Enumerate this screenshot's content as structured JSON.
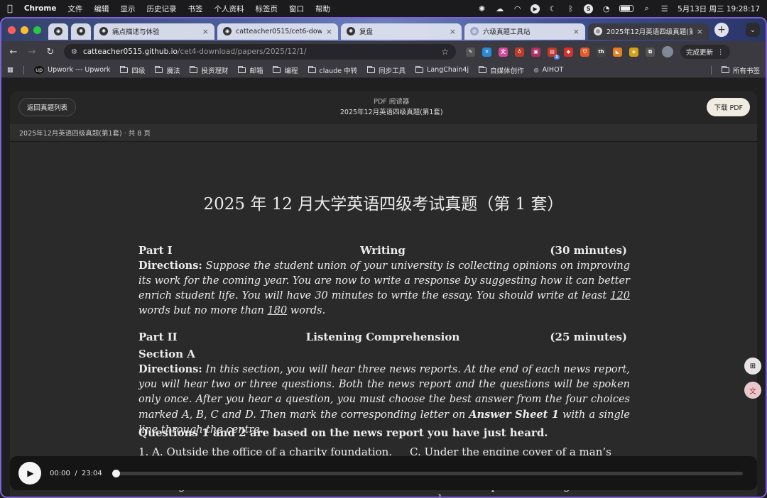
{
  "menubar": {
    "app_name": "Chrome",
    "items": [
      "文件",
      "编辑",
      "显示",
      "历史记录",
      "书签",
      "个人资料",
      "标签页",
      "窗口",
      "帮助"
    ],
    "datetime": "5月13日 周三  19:28:17"
  },
  "tabs": [
    {
      "title": "",
      "icon": "github-icon",
      "pinned": true
    },
    {
      "title": "",
      "icon": "chatgpt-icon",
      "pinned": true
    },
    {
      "title": "痛点描述与体验",
      "icon": "chatgpt-icon"
    },
    {
      "title": "catteacher0515/cet6-downlo",
      "icon": "github-icon"
    },
    {
      "title": "复盘",
      "icon": "chatgpt-icon"
    },
    {
      "title": "六级真题工具站",
      "icon": "globe-icon"
    },
    {
      "title": "2025年12月英语四级真题(第1",
      "icon": "globe-icon",
      "active": true
    }
  ],
  "address": {
    "host": "catteacher0515.github.io",
    "path": "/cet4-download/papers/2025/12/1/"
  },
  "toolbar": {
    "update_label": "完成更新",
    "ext_badge": "1"
  },
  "bookmarks": {
    "items": [
      "Upwork --- Upwork",
      "四级",
      "魔法",
      "投资理财",
      "邮箱",
      "编程",
      "claude 中转",
      "同步工具",
      "LangChain4j",
      "自媒体创作",
      "AIHOT"
    ],
    "all": "所有书签"
  },
  "viewer": {
    "back_label": "返回真题列表",
    "reader_label": "PDF 阅读器",
    "doc_name": "2025年12月英语四级真题(第1套)",
    "download_label": "下载 PDF",
    "subtitle": "2025年12月英语四级真题(第1套) · 共 8 页"
  },
  "document": {
    "title": "2025 年 12 月大学英语四级考试真题（第 1 套）",
    "part1": {
      "left": "Part I",
      "center": "Writing",
      "right": "(30 minutes)"
    },
    "dir1_label": "Directions:",
    "dir1_a": " Suppose the student union of your university is collecting opinions on improving its work for the coming year. You are now to write a response by suggesting how it can better enrich student life. You will have 30 minutes to write the essay. You should write at least ",
    "dir1_min": "120",
    "dir1_b": " words but no more than ",
    "dir1_max": "180",
    "dir1_c": " words.",
    "part2": {
      "left": "Part II",
      "center": "Listening  Comprehension",
      "right": "(25 minutes)"
    },
    "section": "Section A",
    "dir2_label": "Directions:",
    "dir2_a": " In this section, you will hear three news reports. At the end of each news report, you will hear two or three questions. Both the news report and the questions will be spoken only once. After you hear a question, you must choose the best answer from the four choices marked A, B, C and D. Then mark the corresponding letter on ",
    "dir2_sheet": "Answer Sheet 1",
    "dir2_b": " with a single line through the centre.",
    "q_heading": "Questions 1 and 2 are based on the news report you have just heard.",
    "q1_a": "1.   A. Outside the office of a charity foundation.",
    "q1_c": "C. Under the engine cover of a man’s car.",
    "q2_a": "2.   A. It got reunited with its owner.",
    "q2_c": "C. It became a pet of Mr King’s grandson."
  },
  "player": {
    "current": "00:00",
    "divider": "/",
    "total": "23:04",
    "progress": 0
  }
}
